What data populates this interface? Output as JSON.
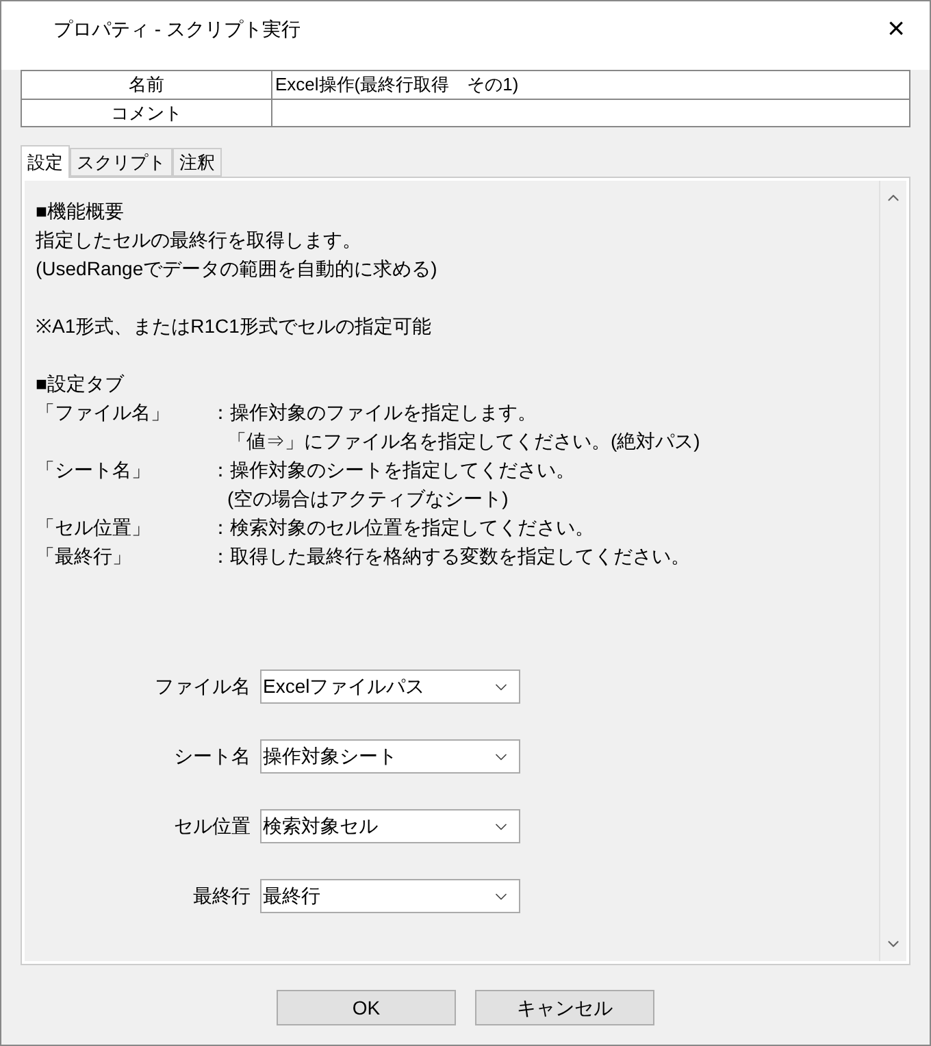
{
  "window": {
    "title": "プロパティ - スクリプト実行",
    "close": "×"
  },
  "properties": [
    {
      "label": "名前",
      "value": "Excel操作(最終行取得　その1)"
    },
    {
      "label": "コメント"
    }
  ],
  "tabs": [
    {
      "label": "設定",
      "selected": true
    },
    {
      "label": "スクリプト",
      "selected": false
    },
    {
      "label": "注釈",
      "selected": false
    }
  ],
  "description": [
    {
      "kind": "text",
      "text": "■機能概要"
    },
    {
      "kind": "text",
      "text": "指定したセルの最終行を取得します。"
    },
    {
      "kind": "text",
      "text": "(UsedRangeでデータの範囲を自動的に求める)"
    },
    {
      "kind": "gap"
    },
    {
      "kind": "text",
      "text": "※A1形式、またはR1C1形式でセルの指定可能"
    },
    {
      "kind": "gap"
    },
    {
      "kind": "text",
      "text": "■設定タブ"
    },
    {
      "kind": "entry",
      "label": "「ファイル名」",
      "text": "：操作対象のファイルを指定します。"
    },
    {
      "kind": "cont",
      "text": "「値⇒」にファイル名を指定してください。(絶対パス)"
    },
    {
      "kind": "entry",
      "label": "「シート名」",
      "text": "：操作対象のシートを指定してください。"
    },
    {
      "kind": "cont",
      "text": "(空の場合はアクティブなシート)"
    },
    {
      "kind": "entry",
      "label": "「セル位置」",
      "text": "：検索対象のセル位置を指定してください。"
    },
    {
      "kind": "entry",
      "label": "「最終行」",
      "text": "：取得した最終行を格納する変数を指定してください。"
    }
  ],
  "fields": [
    {
      "label": "ファイル名",
      "value": "Excelファイルパス"
    },
    {
      "label": "シート名",
      "value": "操作対象シート"
    },
    {
      "label": "セル位置",
      "value": "検索対象セル"
    },
    {
      "label": "最終行",
      "value": "最終行"
    }
  ],
  "buttons": [
    "OK",
    "キャンセル"
  ]
}
